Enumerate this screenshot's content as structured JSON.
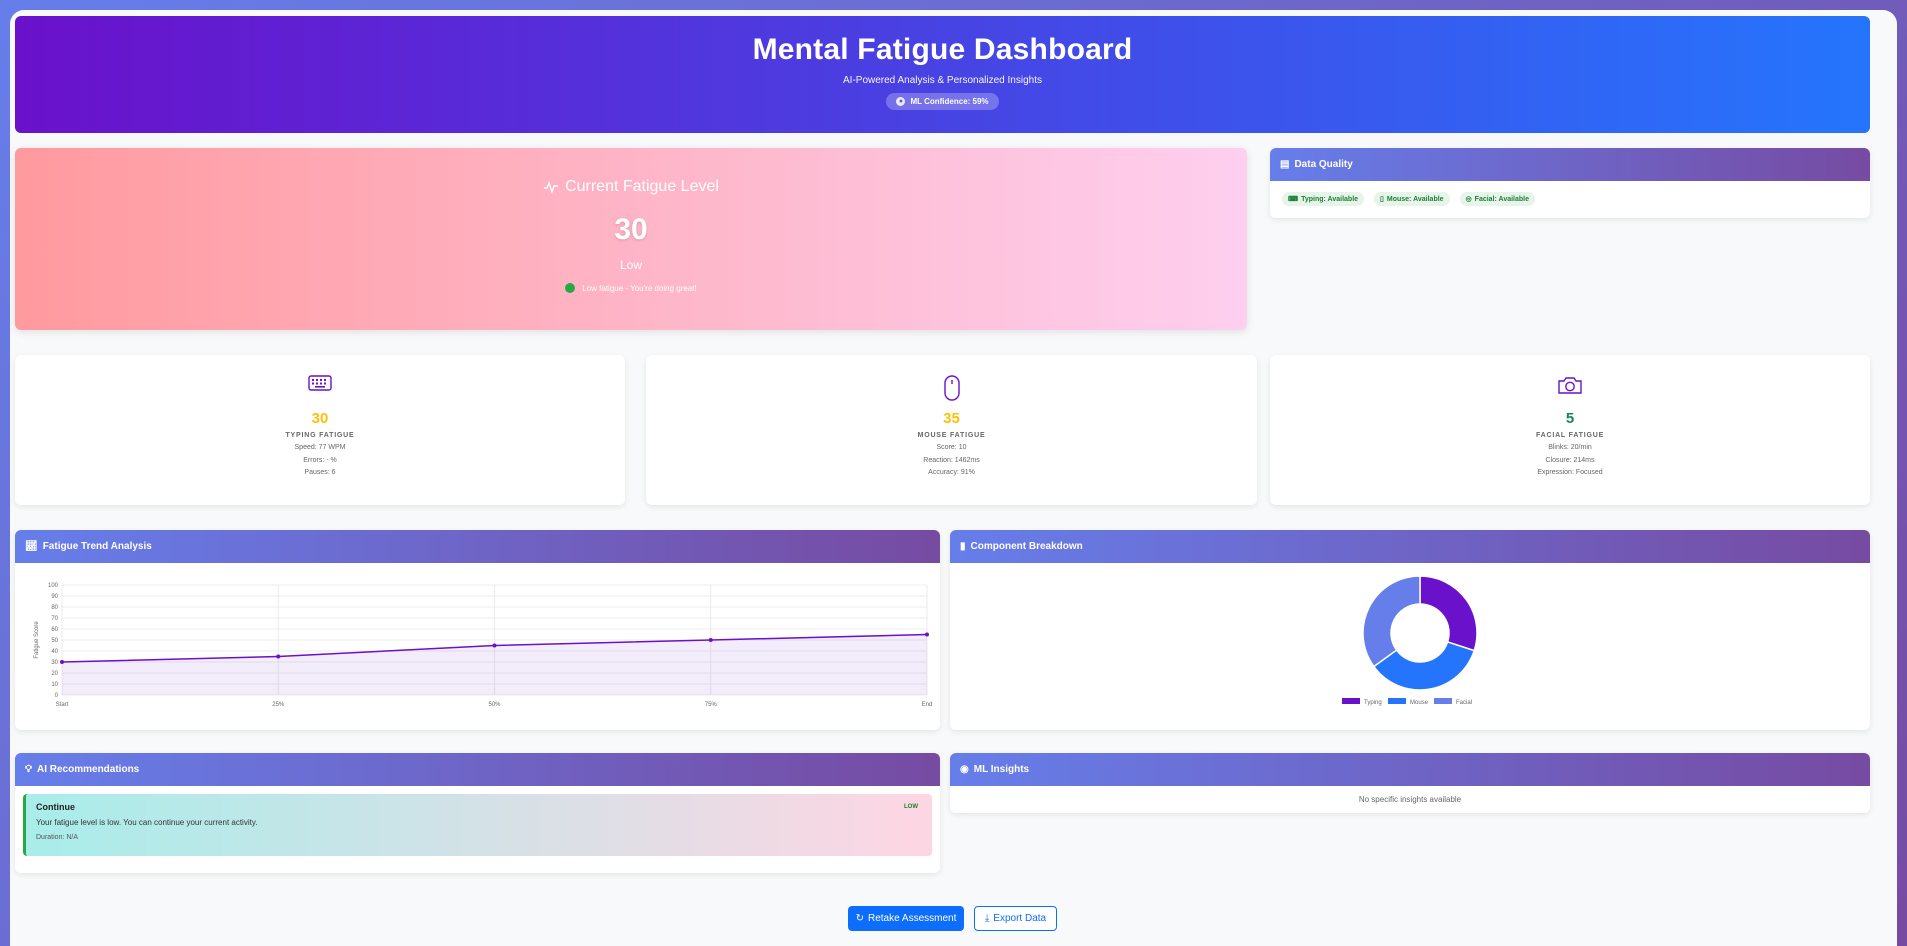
{
  "header": {
    "title": "Mental Fatigue Dashboard",
    "subtitle": "AI-Powered Analysis & Personalized Insights",
    "confidence": "ML Confidence: 59%"
  },
  "current": {
    "title": "Current Fatigue Level",
    "score": "30",
    "level": "Low",
    "status": "Low fatigue - You're doing great!"
  },
  "data_quality": {
    "title": "Data Quality",
    "badges": [
      "Typing: Available",
      "Mouse: Available",
      "Facial: Available"
    ]
  },
  "metrics": [
    {
      "value": "30",
      "label": "TYPING FATIGUE",
      "details": [
        "Speed: 77 WPM",
        "Errors: - %",
        "Pauses: 6"
      ],
      "color": "#ffc107",
      "icon": "keyboard-icon"
    },
    {
      "value": "35",
      "label": "MOUSE FATIGUE",
      "details": [
        "Score: 10",
        "Reaction: 1462ms",
        "Accuracy: 91%"
      ],
      "color": "#ffc107",
      "icon": "mouse-icon"
    },
    {
      "value": "5",
      "label": "FACIAL FATIGUE",
      "details": [
        "Blinks: 20/min",
        "Closure: 214ms",
        "Expression: Focused"
      ],
      "color": "#198754",
      "icon": "camera-icon"
    }
  ],
  "trend": {
    "title": "Fatigue Trend Analysis"
  },
  "breakdown": {
    "title": "Component Breakdown"
  },
  "recommendations": {
    "title": "AI Recommendations",
    "items": [
      {
        "title": "Continue",
        "text": "Your fatigue level is low. You can continue your current activity.",
        "duration": "Duration: N/A",
        "priority": "LOW"
      }
    ]
  },
  "insights": {
    "title": "ML Insights",
    "empty": "No specific insights available"
  },
  "actions": {
    "retake": "Retake Assessment",
    "export": "Export Data"
  },
  "chart_data": [
    {
      "type": "line",
      "title": "",
      "x": [
        "Start",
        "25%",
        "50%",
        "75%",
        "End"
      ],
      "series": [
        {
          "values": [
            30,
            35,
            45,
            50,
            55
          ],
          "color": "#6a11cb"
        }
      ],
      "xlabel": "",
      "ylabel": "Fatigue Score",
      "ylim": [
        0,
        100
      ],
      "yticks": [
        0,
        10,
        20,
        30,
        40,
        50,
        60,
        70,
        80,
        90,
        100
      ],
      "grid": true
    },
    {
      "type": "pie",
      "style": "doughnut",
      "categories": [
        "Typing",
        "Mouse",
        "Facial"
      ],
      "values": [
        30,
        35,
        35
      ],
      "colors": [
        "#6a11cb",
        "#2575fc",
        "#667eea"
      ],
      "legend": "bottom"
    }
  ]
}
